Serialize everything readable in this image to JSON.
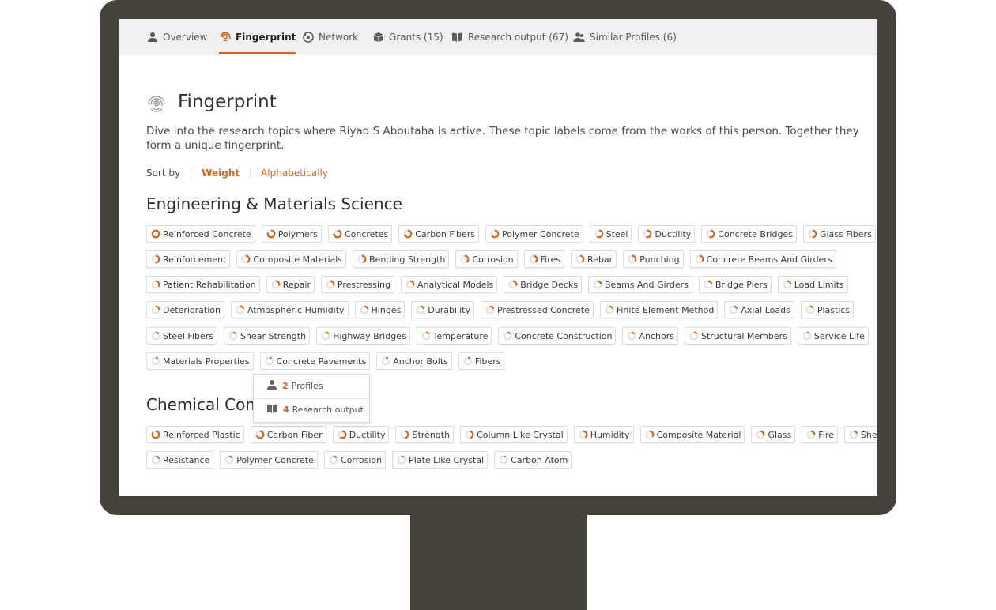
{
  "tabs": [
    {
      "label": "Overview",
      "icon": "person-icon"
    },
    {
      "label": "Fingerprint",
      "icon": "fingerprint-icon",
      "active": true
    },
    {
      "label": "Network",
      "icon": "network-icon"
    },
    {
      "label": "Grants (15)",
      "icon": "box-icon"
    },
    {
      "label": "Research output (67)",
      "icon": "book-icon"
    },
    {
      "label": "Similar Profiles (6)",
      "icon": "people-icon"
    }
  ],
  "page": {
    "title": "Fingerprint",
    "description": "Dive into the research topics where Riyad S Aboutaha is active. These topic labels come from the works of this person. Together they form a unique fingerprint."
  },
  "sort": {
    "label": "Sort by",
    "options": [
      "Weight",
      "Alphabetically"
    ],
    "active": "Weight"
  },
  "colors": {
    "accent": "#d2661e",
    "frame": "#45413b",
    "chip_border": "#dcdcdc"
  },
  "sections": [
    {
      "title": "Engineering & Materials Science",
      "rows": [
        [
          [
            "Reinforced Concrete",
            1.0
          ],
          [
            "Polymers",
            0.8
          ],
          [
            "Concretes",
            0.75
          ],
          [
            "Carbon Fibers",
            0.7
          ],
          [
            "Polymer Concrete",
            0.65
          ],
          [
            "Steel",
            0.6
          ],
          [
            "Ductility",
            0.55
          ],
          [
            "Concrete Bridges",
            0.55
          ],
          [
            "Glass Fibers",
            0.5
          ]
        ],
        [
          [
            "Reinforcement",
            0.5
          ],
          [
            "Composite Materials",
            0.45
          ],
          [
            "Bending Strength",
            0.45
          ],
          [
            "Corrosion",
            0.4
          ],
          [
            "Fires",
            0.4
          ],
          [
            "Rebar",
            0.4
          ],
          [
            "Punching",
            0.35
          ],
          [
            "Concrete Beams And Girders",
            0.35
          ]
        ],
        [
          [
            "Patient Rehabilitation",
            0.35
          ],
          [
            "Repair",
            0.3
          ],
          [
            "Prestressing",
            0.3
          ],
          [
            "Analytical Models",
            0.3
          ],
          [
            "Bridge Decks",
            0.3
          ],
          [
            "Beams And Girders",
            0.25
          ],
          [
            "Bridge Piers",
            0.25
          ],
          [
            "Load Limits",
            0.25
          ]
        ],
        [
          [
            "Deterioration",
            0.25
          ],
          [
            "Atmospheric Humidity",
            0.2
          ],
          [
            "Hinges",
            0.2
          ],
          [
            "Durability",
            0.2
          ],
          [
            "Prestressed Concrete",
            0.2
          ],
          [
            "Finite Element Method",
            0.2
          ],
          [
            "Axial Loads",
            0.2
          ],
          [
            "Plastics",
            0.15
          ]
        ],
        [
          [
            "Steel Fibers",
            0.15
          ],
          [
            "Shear Strength",
            0.15
          ],
          [
            "Highway Bridges",
            0.15
          ],
          [
            "Temperature",
            0.15
          ],
          [
            "Concrete Construction",
            0.15
          ],
          [
            "Anchors",
            0.15
          ],
          [
            "Structural Members",
            0.15
          ],
          [
            "Service Life",
            0.1
          ]
        ],
        [
          [
            "Materials Properties",
            0.1
          ],
          [
            "Concrete Pavements",
            0.1
          ],
          [
            "Anchor Bolts",
            0.1
          ],
          [
            "Fibers",
            0.1
          ]
        ]
      ]
    },
    {
      "title": "Chemical Compounds",
      "rows": [
        [
          [
            "Reinforced Plastic",
            0.85
          ],
          [
            "Carbon Fiber",
            0.7
          ],
          [
            "Ductility",
            0.6
          ],
          [
            "Strength",
            0.5
          ],
          [
            "Column Like Crystal",
            0.45
          ],
          [
            "Humidity",
            0.4
          ],
          [
            "Composite Material",
            0.35
          ],
          [
            "Glass",
            0.3
          ],
          [
            "Fire",
            0.25
          ],
          [
            "Shear",
            0.2
          ]
        ],
        [
          [
            "Resistance",
            0.2
          ],
          [
            "Polymer Concrete",
            0.15
          ],
          [
            "Corrosion",
            0.15
          ],
          [
            "Plate Like Crystal",
            0.1
          ],
          [
            "Carbon Atom",
            0.1
          ]
        ]
      ]
    }
  ],
  "popover": {
    "profiles_count": "2",
    "profiles_label": "Profiles",
    "research_count": "4",
    "research_label": "Research output"
  }
}
